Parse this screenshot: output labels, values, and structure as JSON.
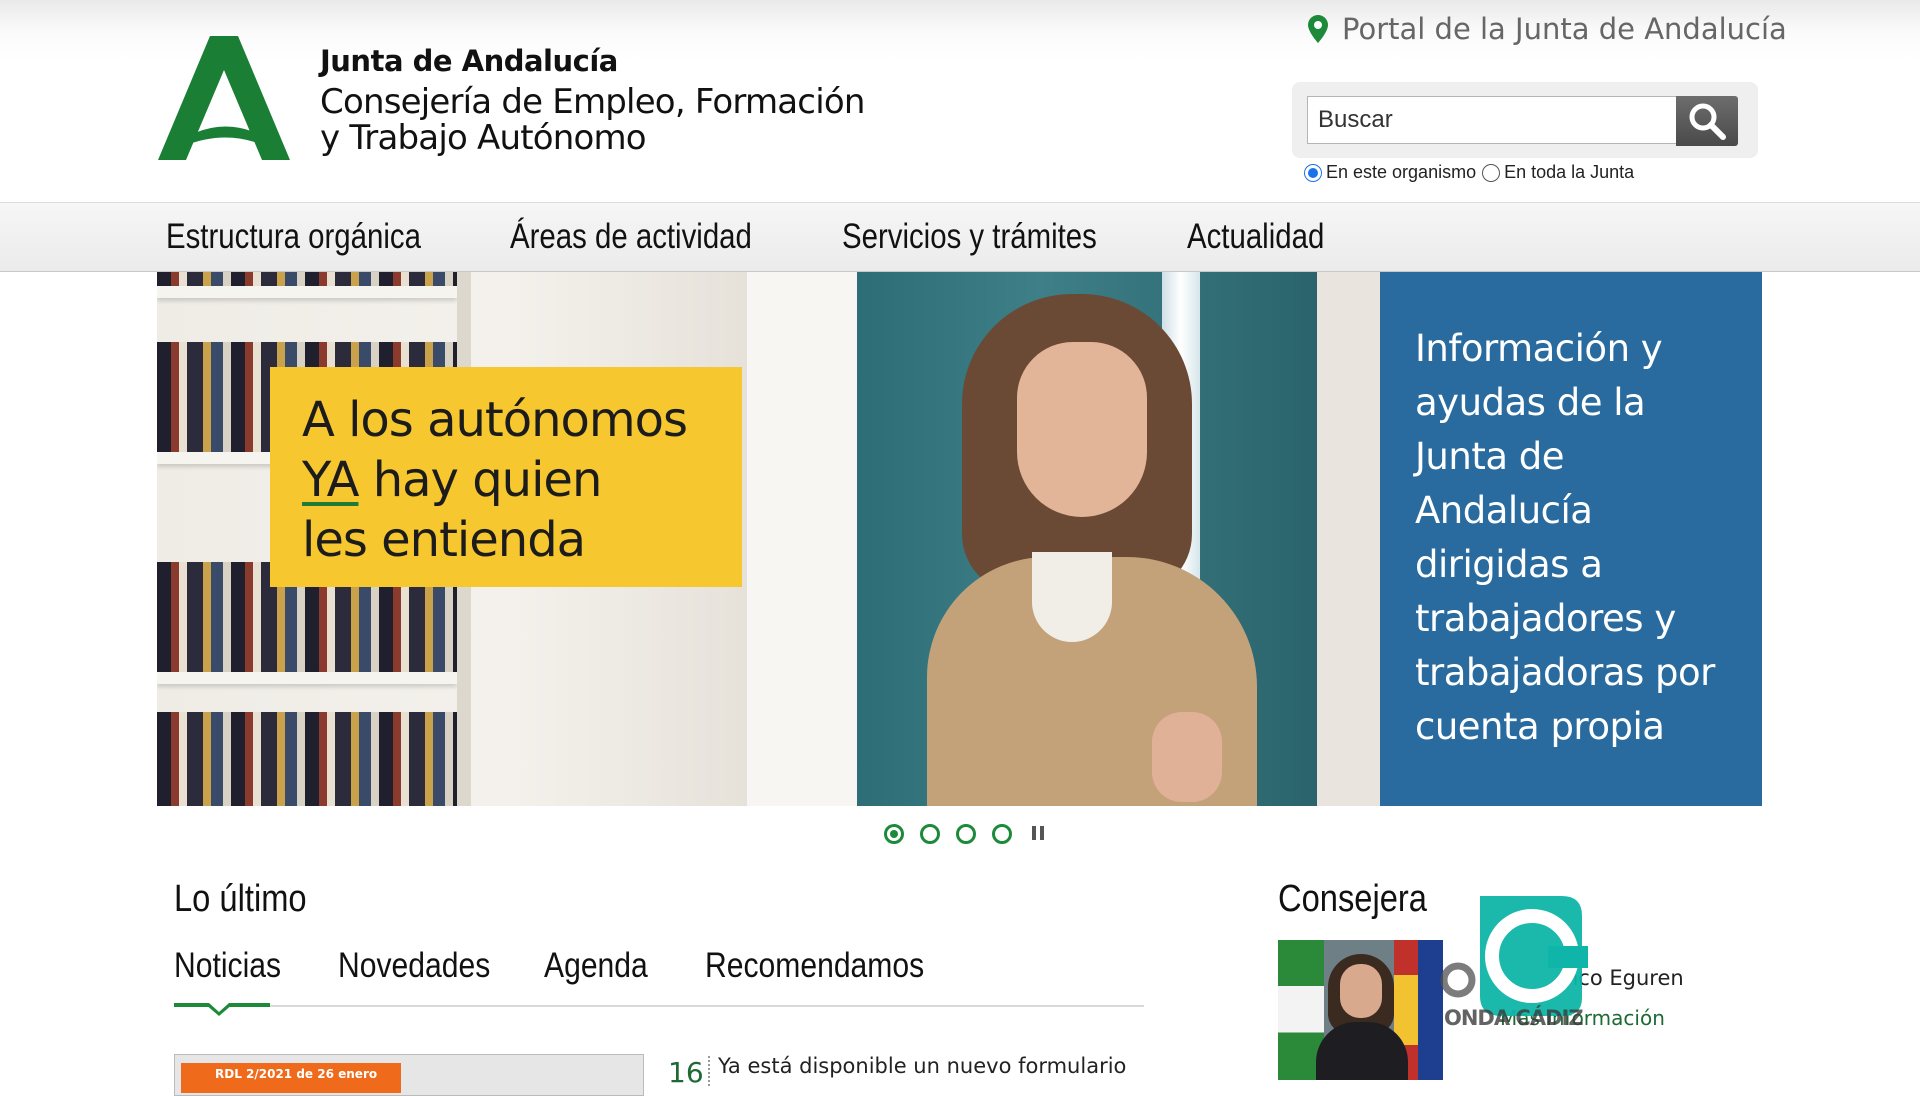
{
  "header": {
    "org_name": "Junta de Andalucía",
    "department_line1": "Consejería de Empleo, Formación",
    "department_line2": "y Trabajo Autónomo",
    "portal_link": "Portal de la Junta de Andalucía"
  },
  "search": {
    "placeholder": "Buscar",
    "value": "",
    "scope_options": [
      "En este organismo",
      "En toda la Junta"
    ],
    "selected_scope": "En este organismo"
  },
  "nav": {
    "items": [
      "Estructura orgánica",
      "Áreas de actividad",
      "Servicios y trámites",
      "Actualidad"
    ]
  },
  "banner": {
    "headline_line1": "A los autónomos",
    "headline_ya": "YA",
    "headline_line2_rest": " hay quien",
    "headline_line3": "les entienda",
    "side_text": "Información y ayudas de la Junta de Andalucía dirigidas a trabajadores y trabajadoras por cuenta propia",
    "slide_count": 4,
    "active_slide": 1
  },
  "latest": {
    "title": "Lo último",
    "tabs": [
      "Noticias",
      "Novedades",
      "Agenda",
      "Recomendamos"
    ],
    "active_tab": "Noticias",
    "news": [
      {
        "thumb_label": "RDL 2/2021 de 26 enero",
        "day": "16",
        "title": "Ya está disponible un nuevo formulario"
      }
    ]
  },
  "consejera": {
    "title": "Consejera",
    "name_fragment": "nco Eguren",
    "more_link": "Más información"
  },
  "watermark": {
    "text": "ONDA CÁDIZ"
  },
  "colors": {
    "brand_green": "#1d8a3a",
    "banner_blue": "#2a6b9f",
    "banner_yellow": "#f6c72f",
    "watermark_teal": "#0fb5a8"
  }
}
